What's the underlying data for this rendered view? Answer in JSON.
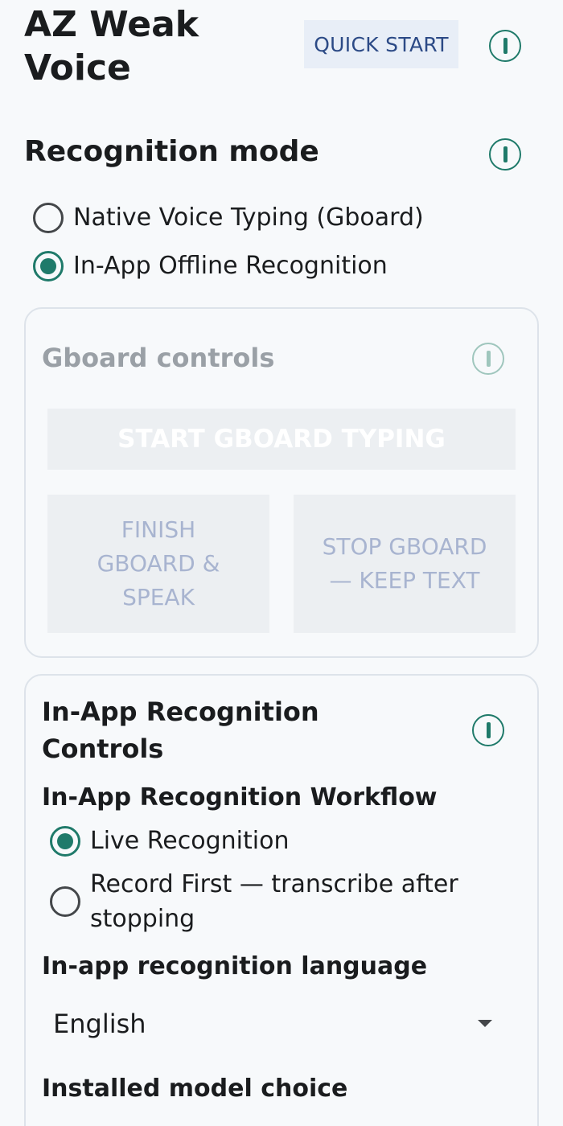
{
  "header": {
    "app_title_line1": "AZ Weak",
    "app_title_line2": "Voice",
    "quick_start_label": "QUICK START"
  },
  "recognition_mode": {
    "title": "Recognition mode",
    "options": [
      {
        "label": "Native Voice Typing (Gboard)",
        "selected": false
      },
      {
        "label": "In-App Offline Recognition",
        "selected": true
      }
    ]
  },
  "gboard_controls": {
    "title": "Gboard controls",
    "start_label": "START GBOARD TYPING",
    "finish_label_l1": "FINISH",
    "finish_label_l2": "GBOARD &",
    "finish_label_l3": "SPEAK",
    "stop_label_l1": "STOP GBOARD",
    "stop_label_l2": "— KEEP TEXT"
  },
  "inapp_controls": {
    "title_l1": "In-App Recognition",
    "title_l2": "Controls",
    "workflow_title": "In-App Recognition Workflow",
    "workflow_options": [
      {
        "label": "Live Recognition",
        "selected": true
      },
      {
        "label_l1": "Record First — transcribe after",
        "label_l2": "stopping",
        "selected": false
      }
    ],
    "language_title": "In-app recognition language",
    "language_value": "English",
    "model_title": "Installed model choice"
  },
  "colors": {
    "accent": "#1f7a6a",
    "quick_start_bg": "#e8eef7",
    "quick_start_text": "#2c4a86"
  }
}
